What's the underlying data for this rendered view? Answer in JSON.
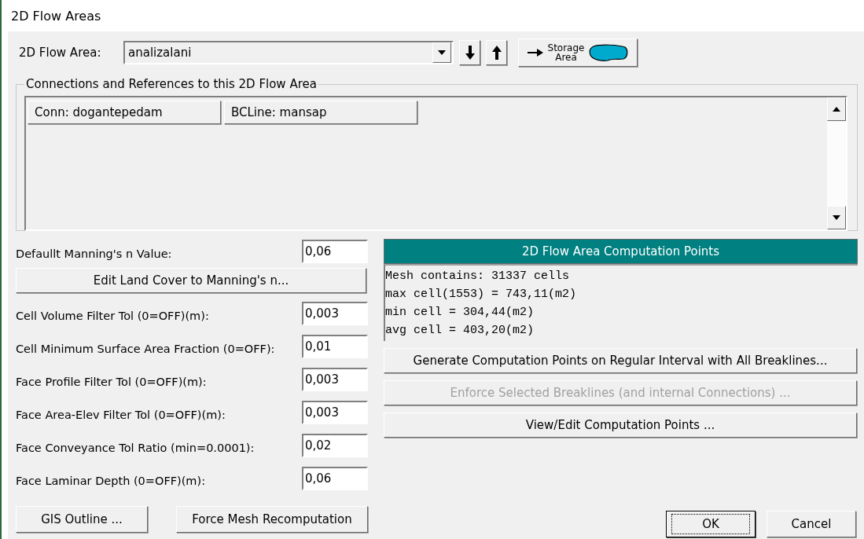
{
  "window": {
    "title": "2D Flow Areas"
  },
  "flow_area": {
    "label": "2D Flow Area:",
    "value": "analizalani"
  },
  "storage_button": {
    "label": "Storage Area"
  },
  "connections": {
    "title": "Connections and References to this 2D Flow Area",
    "items": [
      "Conn: dogantepedam",
      "BCLine: mansap"
    ]
  },
  "default_mannings": {
    "label": "Defaullt Manning's n Value:",
    "value": "0,06"
  },
  "land_cover_button": "Edit Land Cover to Manning's n...",
  "tolerances": [
    {
      "label": "Cell Volume Filter Tol (0=OFF)(m):",
      "value": "0,003"
    },
    {
      "label": "Cell Minimum Surface Area Fraction (0=OFF):",
      "value": "0,01"
    },
    {
      "label": "Face Profile Filter Tol (0=OFF)(m):",
      "value": "0,003"
    },
    {
      "label": "Face Area-Elev Filter Tol (0=OFF)(m):",
      "value": "0,003"
    },
    {
      "label": "Face Conveyance Tol Ratio (min=0.0001):",
      "value": "0,02"
    },
    {
      "label": "Face Laminar Depth (0=OFF)(m):",
      "value": "0,06"
    }
  ],
  "computation_points": {
    "title": "2D Flow Area Computation Points",
    "lines": [
      "Mesh contains: 31337 cells",
      "max cell(1553) = 743,11(m2)",
      "min cell = 304,44(m2)",
      "avg cell = 403,20(m2)"
    ]
  },
  "actions": [
    {
      "label": "Generate Computation Points on Regular Interval with All Breaklines...",
      "disabled": false
    },
    {
      "label": "Enforce Selected Breaklines (and internal Connections) ...",
      "disabled": true
    },
    {
      "label": "View/Edit Computation Points ...",
      "disabled": false
    }
  ],
  "bottom_left": [
    "GIS Outline ...",
    "Force Mesh Recomputation"
  ],
  "dialog_buttons": [
    {
      "label": "OK",
      "focused": true
    },
    {
      "label": "Cancel",
      "focused": false
    }
  ]
}
